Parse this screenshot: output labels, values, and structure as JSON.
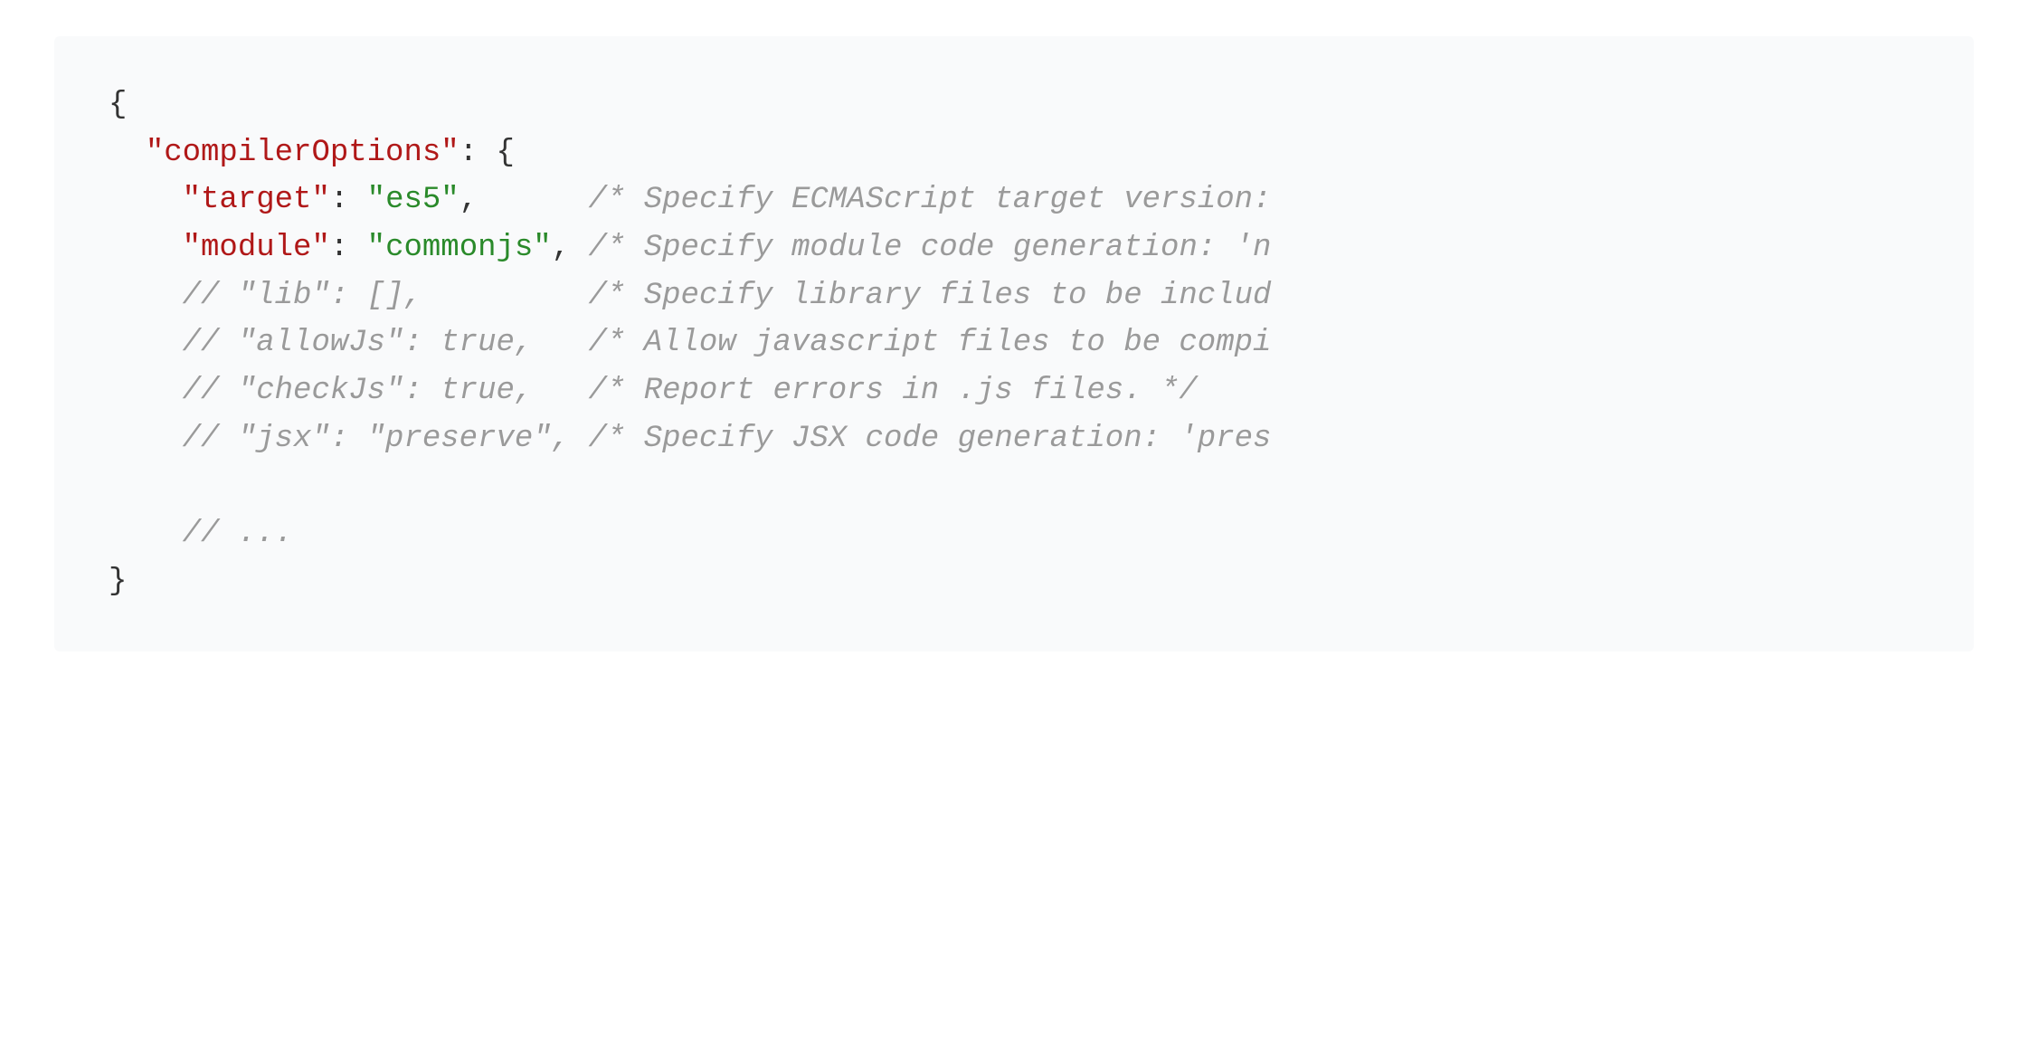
{
  "code": {
    "line1": "{",
    "line2_indent": "  ",
    "line2_key": "\"compilerOptions\"",
    "line2_colon": ": ",
    "line2_brace": "{",
    "line3_indent": "    ",
    "line3_key": "\"target\"",
    "line3_colon": ": ",
    "line3_val": "\"es5\"",
    "line3_comma": ",",
    "line3_pad": "      ",
    "line3_comment": "/* Specify ECMAScript target version:",
    "line4_indent": "    ",
    "line4_key": "\"module\"",
    "line4_colon": ": ",
    "line4_val": "\"commonjs\"",
    "line4_comma": ",",
    "line4_pad": " ",
    "line4_comment": "/* Specify module code generation: 'n",
    "line5_indent": "    ",
    "line5_comment": "// \"lib\": [],         /* Specify library files to be includ",
    "line6_indent": "    ",
    "line6_comment": "// \"allowJs\": true,   /* Allow javascript files to be compi",
    "line7_indent": "    ",
    "line7_comment": "// \"checkJs\": true,   /* Report errors in .js files. */",
    "line8_indent": "    ",
    "line8_comment": "// \"jsx\": \"preserve\", /* Specify JSX code generation: 'pres",
    "line9": "",
    "line10_indent": "    ",
    "line10_comment": "// ...",
    "line11": "}"
  }
}
